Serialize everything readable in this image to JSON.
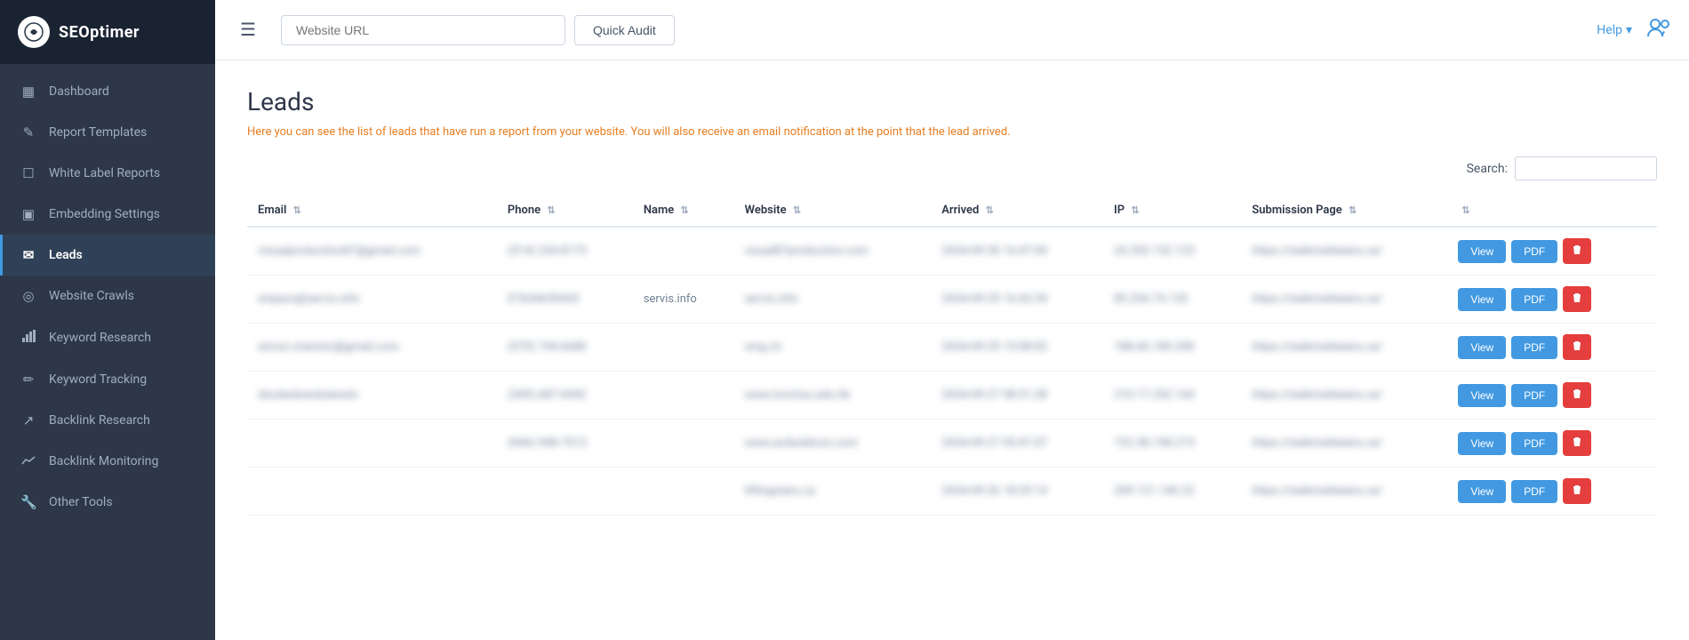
{
  "app": {
    "name": "SEOptimer",
    "logo_symbol": "⚙"
  },
  "topbar": {
    "url_placeholder": "Website URL",
    "quick_audit_label": "Quick Audit",
    "help_label": "Help",
    "hamburger_label": "☰"
  },
  "sidebar": {
    "items": [
      {
        "id": "dashboard",
        "label": "Dashboard",
        "icon": "▦",
        "active": false
      },
      {
        "id": "report-templates",
        "label": "Report Templates",
        "icon": "✎",
        "active": false
      },
      {
        "id": "white-label-reports",
        "label": "White Label Reports",
        "icon": "☐",
        "active": false
      },
      {
        "id": "embedding-settings",
        "label": "Embedding Settings",
        "icon": "▣",
        "active": false
      },
      {
        "id": "leads",
        "label": "Leads",
        "icon": "✉",
        "active": true
      },
      {
        "id": "website-crawls",
        "label": "Website Crawls",
        "icon": "◎",
        "active": false
      },
      {
        "id": "keyword-research",
        "label": "Keyword Research",
        "icon": "📊",
        "active": false
      },
      {
        "id": "keyword-tracking",
        "label": "Keyword Tracking",
        "icon": "✏",
        "active": false
      },
      {
        "id": "backlink-research",
        "label": "Backlink Research",
        "icon": "↗",
        "active": false
      },
      {
        "id": "backlink-monitoring",
        "label": "Backlink Monitoring",
        "icon": "📈",
        "active": false
      },
      {
        "id": "other-tools",
        "label": "Other Tools",
        "icon": "🔧",
        "active": false
      }
    ]
  },
  "page": {
    "title": "Leads",
    "description": "Here you can see the list of leads that have run a report from your website. You will also receive an email notification at the point that the lead arrived.",
    "search_label": "Search:",
    "search_placeholder": ""
  },
  "table": {
    "columns": [
      {
        "key": "email",
        "label": "Email"
      },
      {
        "key": "phone",
        "label": "Phone"
      },
      {
        "key": "name",
        "label": "Name"
      },
      {
        "key": "website",
        "label": "Website"
      },
      {
        "key": "arrived",
        "label": "Arrived"
      },
      {
        "key": "ip",
        "label": "IP"
      },
      {
        "key": "submission_page",
        "label": "Submission Page"
      }
    ],
    "rows": [
      {
        "email": "visualproduction87@gmail.com",
        "phone": "(514) 234-8173",
        "name": "",
        "website": "visual87production.com",
        "arrived": "2024-09-30 16:47:04",
        "ip": "24.202.152.123",
        "submission_page": "https://webmarketers.ca/"
      },
      {
        "email": "enipars@servis.info",
        "phone": "07634630435",
        "name": "servis.info",
        "website": "servis.info",
        "arrived": "2024-09-29 16:42:34",
        "ip": "85.254.74.135",
        "submission_page": "https://webmarketers.ca/"
      },
      {
        "email": "simon.chanton@gmail.com",
        "phone": "(570) 194-6680",
        "name": "",
        "website": "wng.ch",
        "arrived": "2024-09-29 15:08:02",
        "ip": "188.60.189.200",
        "submission_page": "https://webmarketers.ca/"
      },
      {
        "email": "dscdwdswdsdwsdv",
        "phone": "(345) 687-6942",
        "name": "",
        "website": "www.invictus.edu.hk",
        "arrived": "2024-09-27 08:51:28",
        "ip": "210.17.252.164",
        "submission_page": "https://webmarketers.ca/"
      },
      {
        "email": "",
        "phone": "(946) 948-7013",
        "name": "",
        "website": "www.acibuildcon.com",
        "arrived": "2024-09-27 05:41:07",
        "ip": "152.58.198.219",
        "submission_page": "https://webmarketers.ca/"
      },
      {
        "email": "",
        "phone": "",
        "name": "",
        "website": "liftingstars.ca",
        "arrived": "2024-09-26 18:29:14",
        "ip": "209.121.140.22",
        "submission_page": "https://webmarketers.ca/"
      }
    ],
    "btn_view": "View",
    "btn_pdf": "PDF"
  }
}
